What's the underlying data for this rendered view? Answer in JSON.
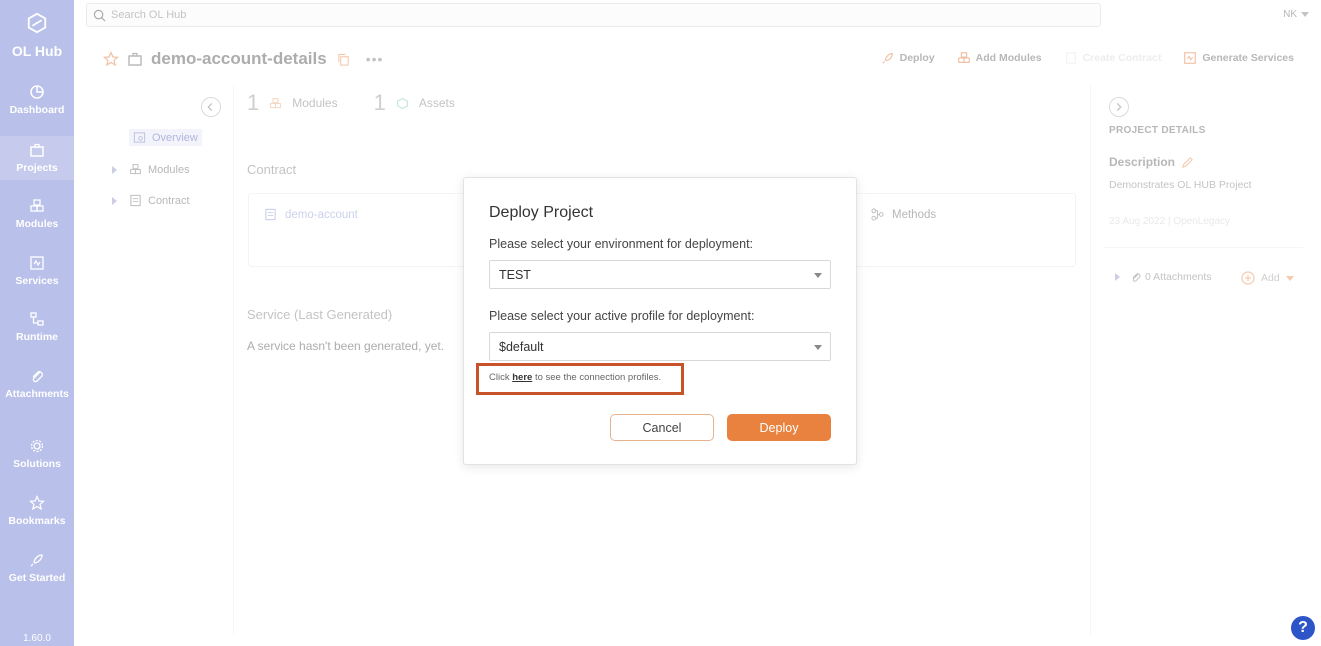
{
  "app": {
    "name": "OL Hub",
    "version": "1.60.0"
  },
  "rail": [
    {
      "label": "Dashboard",
      "icon": "pie-chart-icon"
    },
    {
      "label": "Projects",
      "icon": "briefcase-icon"
    },
    {
      "label": "Modules",
      "icon": "cubes-icon"
    },
    {
      "label": "Services",
      "icon": "code-window-icon"
    },
    {
      "label": "Runtime",
      "icon": "flow-icon"
    },
    {
      "label": "Attachments",
      "icon": "paperclip-icon"
    },
    {
      "label": "Solutions",
      "icon": "gear-icon"
    },
    {
      "label": "Bookmarks",
      "icon": "star-icon"
    },
    {
      "label": "Get Started",
      "icon": "rocket-icon"
    }
  ],
  "topbar": {
    "search_placeholder": "Search OL Hub",
    "user": "NK"
  },
  "project": {
    "title": "demo-account-details"
  },
  "actions": {
    "deploy": "Deploy",
    "add_modules": "Add Modules",
    "create_contract": "Create Contract",
    "generate_services": "Generate Services"
  },
  "tree": {
    "overview": "Overview",
    "modules": "Modules",
    "contract": "Contract"
  },
  "stats": {
    "modules_count": "1",
    "modules_label": "Modules",
    "assets_count": "1",
    "assets_label": "Assets"
  },
  "contract": {
    "section_label": "Contract",
    "name": "demo-account",
    "methods": "Methods"
  },
  "service": {
    "section_label": "Service (Last Generated)",
    "empty_text": "A service hasn't been generated, yet."
  },
  "details": {
    "heading": "PROJECT DETAILS",
    "description_label": "Description",
    "description": "Demonstrates OL HUB Project",
    "meta": "23 Aug 2022 | OpenLegacy",
    "attachments": "0 Attachments",
    "add": "Add"
  },
  "modal": {
    "title": "Deploy Project",
    "env_label": "Please select your environment for deployment:",
    "env_value": "TEST",
    "profile_label": "Please select your active profile for deployment:",
    "profile_value": "$default",
    "hint_prefix": "Click ",
    "hint_link": "here",
    "hint_suffix": " to see the connection profiles.",
    "cancel": "Cancel",
    "deploy": "Deploy"
  },
  "colors": {
    "rail": "#b9c0e9",
    "accent": "#e8823e",
    "highlight": "#c8522a",
    "help": "#2d55c8"
  }
}
